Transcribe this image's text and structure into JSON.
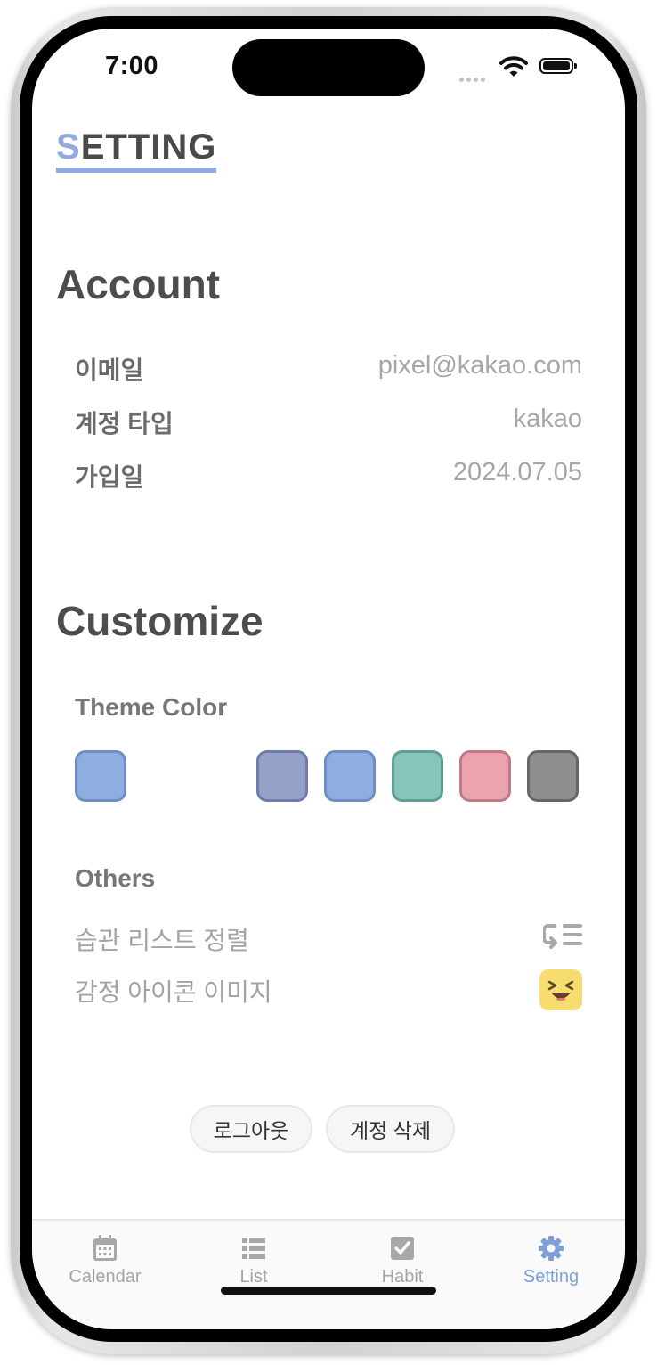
{
  "status": {
    "time": "7:00"
  },
  "page": {
    "title_first": "S",
    "title_rest": "ETTING"
  },
  "account": {
    "heading": "Account",
    "rows": [
      {
        "label": "이메일",
        "value": "pixel@kakao.com"
      },
      {
        "label": "계정 타입",
        "value": "kakao"
      },
      {
        "label": "가입일",
        "value": "2024.07.05"
      }
    ]
  },
  "customize": {
    "heading": "Customize",
    "theme_label": "Theme Color",
    "selected_color": "#8eaee2",
    "colors": [
      "#96a1c9",
      "#8eaee2",
      "#87c5b9",
      "#eba3ad",
      "#8e8e8e"
    ],
    "others_label": "Others",
    "others": [
      {
        "label": "습관 리스트 정렬",
        "icon": "sort-icon"
      },
      {
        "label": "감정 아이콘 이미지",
        "icon": "emoji-icon"
      }
    ]
  },
  "actions": {
    "logout": "로그아웃",
    "delete_account": "계정 삭제"
  },
  "tabs": [
    {
      "label": "Calendar",
      "icon": "calendar-icon"
    },
    {
      "label": "List",
      "icon": "list-icon"
    },
    {
      "label": "Habit",
      "icon": "checkbox-icon"
    },
    {
      "label": "Setting",
      "icon": "gear-icon",
      "active": true
    }
  ]
}
